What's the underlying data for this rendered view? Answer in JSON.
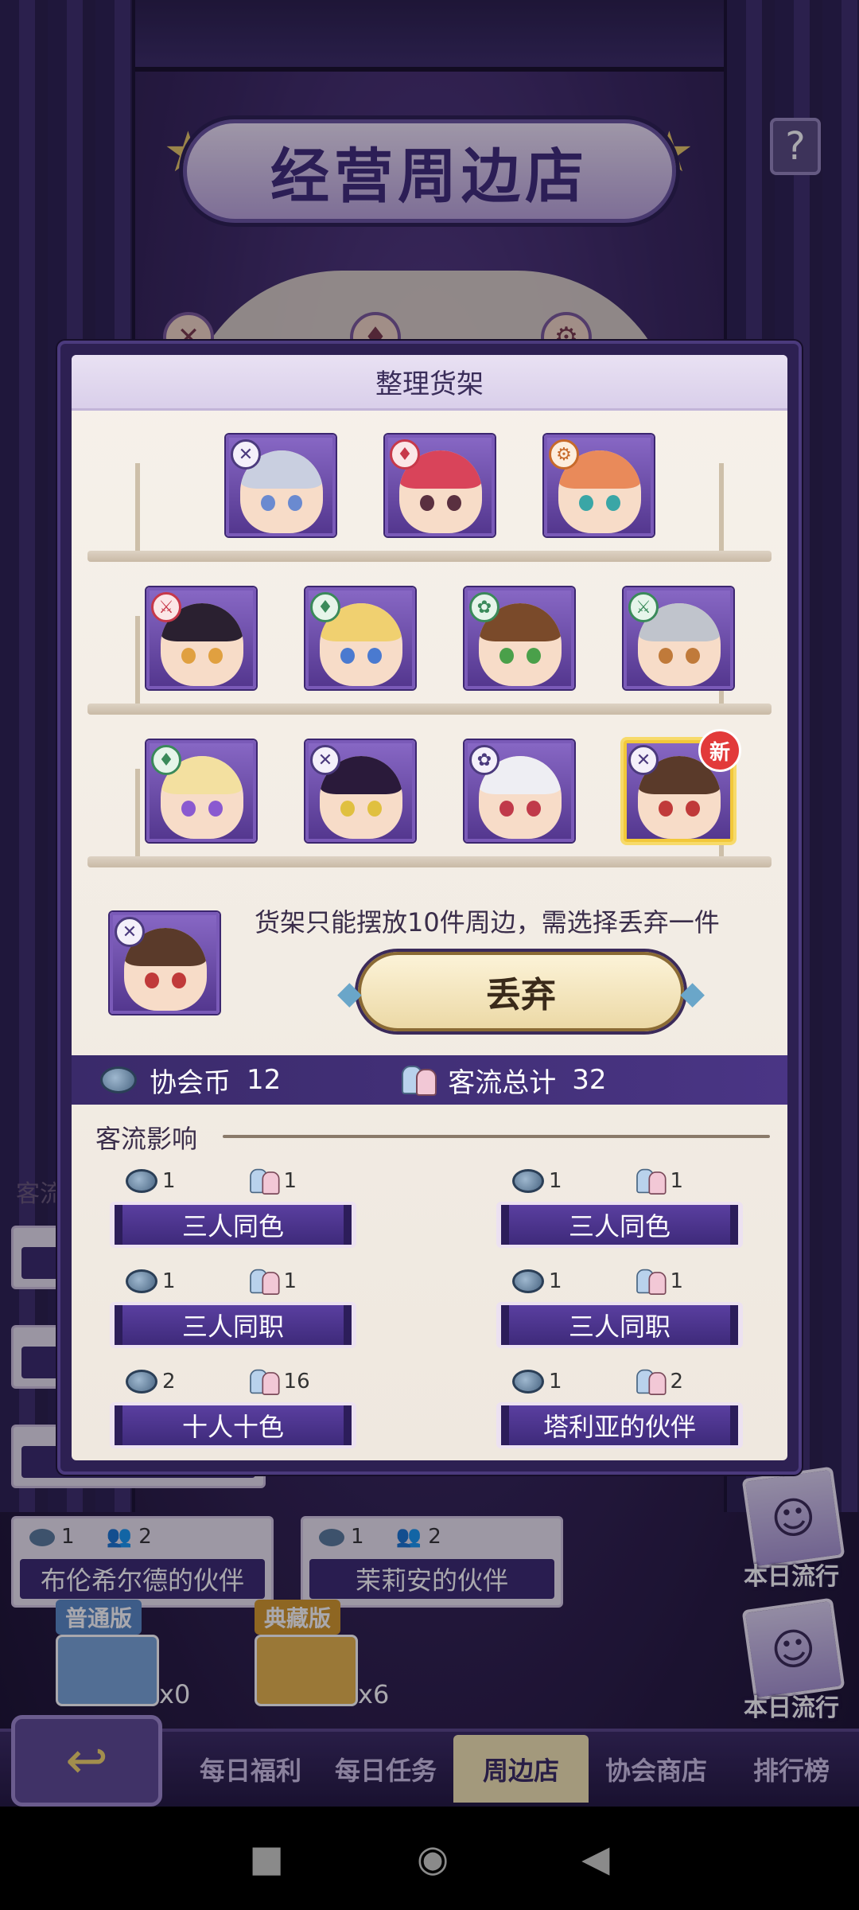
{
  "header": {
    "title": "经营周边店",
    "help_label": "?"
  },
  "dialog": {
    "title": "整理货架",
    "notice": "货架只能摆放10件周边，需选择丢弃一件",
    "discard_label": "丢弃",
    "new_label": "新",
    "stats": {
      "coin_label": "协会币",
      "coin_value": "12",
      "traffic_label": "客流总计",
      "traffic_value": "32"
    },
    "section_title": "客流影响",
    "effects": [
      {
        "coin": "1",
        "people": "1",
        "label": "三人同色"
      },
      {
        "coin": "1",
        "people": "1",
        "label": "三人同色"
      },
      {
        "coin": "1",
        "people": "1",
        "label": "三人同职"
      },
      {
        "coin": "1",
        "people": "1",
        "label": "三人同职"
      },
      {
        "coin": "2",
        "people": "16",
        "label": "十人十色"
      },
      {
        "coin": "1",
        "people": "2",
        "label": "塔利亚的伙伴"
      }
    ]
  },
  "background": {
    "list_label": "客流",
    "items": [
      {
        "coin": "1",
        "people": "2",
        "label": "布伦希尔德的伙伴"
      },
      {
        "coin": "1",
        "people": "2",
        "label": "茉莉安的伙伴"
      }
    ],
    "packs": [
      {
        "tag": "普通版",
        "count": "x0",
        "color": "#5a8ac6"
      },
      {
        "tag": "典藏版",
        "count": "x6",
        "color": "#d69a2a"
      }
    ],
    "popular_label": "本日流行"
  },
  "bottom_nav": {
    "back": "↩",
    "tabs": [
      "每日福利",
      "每日任务",
      "周边店",
      "协会商店",
      "排行榜"
    ],
    "active_index": 2
  },
  "colors": {
    "accent": "#4a3585",
    "gold": "#f2c83a",
    "panel": "#f6f1ea"
  }
}
